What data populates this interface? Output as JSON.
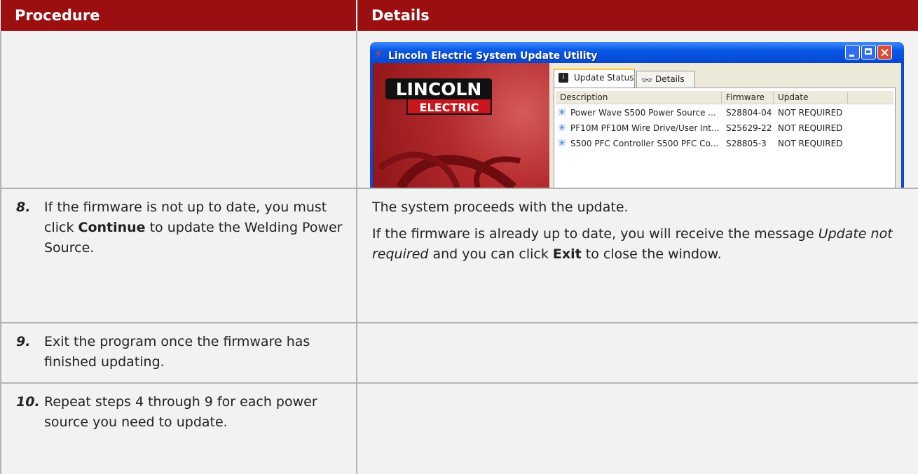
{
  "table": {
    "headers": {
      "procedure": "Procedure",
      "details": "Details"
    },
    "screenshot": {
      "window_title": "Lincoln Electric System Update Utility",
      "logo_top": "LINCOLN",
      "logo_bottom": "ELECTRIC",
      "tabs": [
        {
          "label": "Update Status",
          "active": true
        },
        {
          "label": "Details",
          "active": false
        }
      ],
      "columns": {
        "description": "Description",
        "firmware": "Firmware",
        "update": "Update"
      },
      "rows": [
        {
          "description": "Power Wave S500 Power Source ...",
          "firmware": "S28804-04",
          "update": "NOT REQUIRED"
        },
        {
          "description": "PF10M PF10M Wire Drive/User Int...",
          "firmware": "S25629-22",
          "update": "NOT REQUIRED"
        },
        {
          "description": "S500 PFC Controller S500 PFC Co...",
          "firmware": "S28805-3",
          "update": "NOT REQUIRED"
        }
      ]
    },
    "steps": [
      {
        "number": "8.",
        "text_before": "If the firmware is not up to date, you must click ",
        "text_bold": "Continue",
        "text_after": " to update the Welding Power Source.",
        "details_p1": "The system proceeds with the update.",
        "details_p2_a": "If the firmware is already up to date, you will receive the message ",
        "details_p2_italic": "Update not required",
        "details_p2_b": " and you can click ",
        "details_p2_bold": "Exit",
        "details_p2_c": " to close the window."
      },
      {
        "number": "9.",
        "text": "Exit the program once the firmware has finished updating."
      },
      {
        "number": "10.",
        "text": "Repeat steps 4 through 9 for each power source you need to update."
      }
    ]
  },
  "colors": {
    "header_bg": "#9b0f11",
    "cell_bg": "#f2f2f2",
    "border": "#b3b3b3"
  }
}
